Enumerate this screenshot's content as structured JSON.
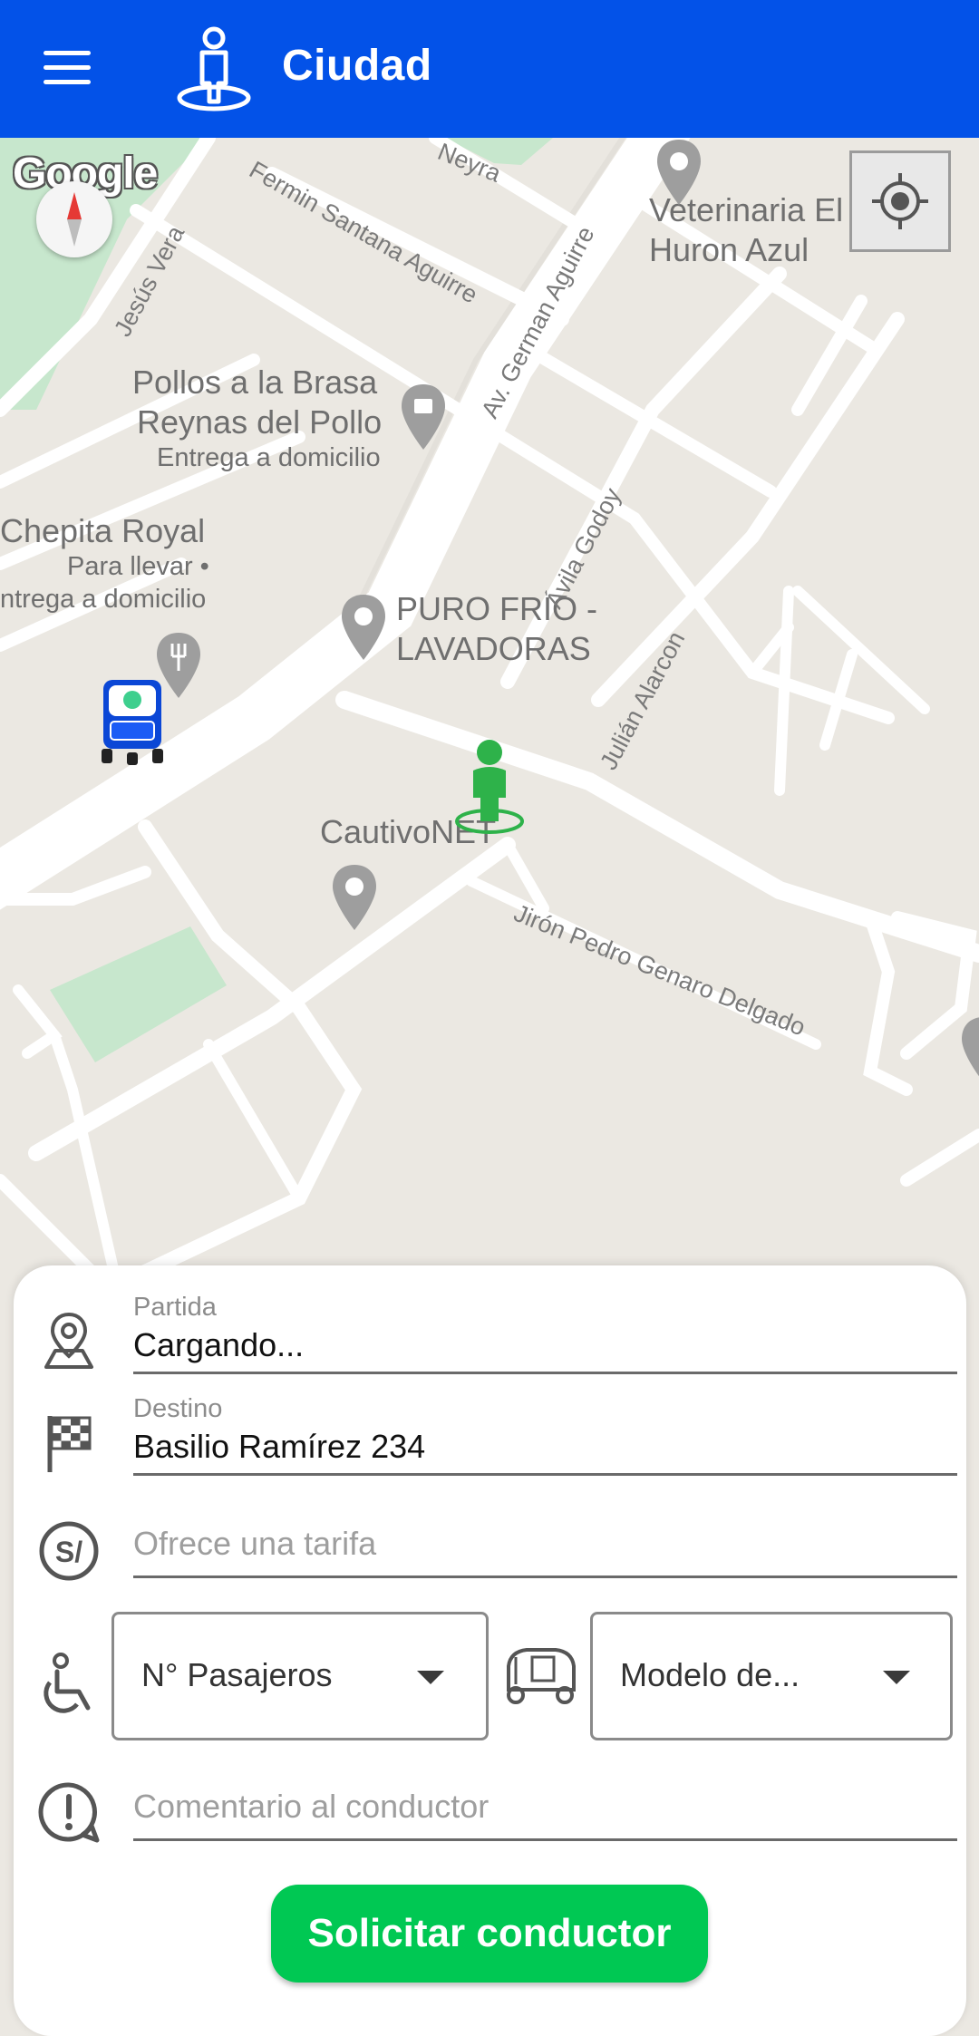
{
  "appbar": {
    "title": "Ciudad",
    "bg_color": "#0352e8"
  },
  "map": {
    "google_logo": "Google",
    "places": {
      "veterinaria_1": "Veterinaria El",
      "veterinaria_2": "Huron Azul",
      "pollos_1": "Pollos a la Brasa",
      "pollos_2": "Reynas del Pollo",
      "pollos_3": "Entrega a domicilio",
      "chepita_1": "Chepita Royal",
      "chepita_2": "Para llevar •",
      "chepita_3": "ntrega a domicilio",
      "purofrio_1": "PURO FRIO -",
      "purofrio_2": "LAVADORAS",
      "cautivo": "CautivoNET"
    },
    "streets": {
      "neyra": "Neyra",
      "fermin": "Fermin Santana Aguirre",
      "jesus": "Jesús Vera",
      "german": "Av. German Aguirre",
      "avila": "Ávila Godoy",
      "julian": "Julián Alarcon",
      "jiron": "Jirón Pedro Genaro Delgado"
    }
  },
  "form": {
    "origin": {
      "label": "Partida",
      "value": "Cargando..."
    },
    "destination": {
      "label": "Destino",
      "value": "Basilio Ramírez 234"
    },
    "fare": {
      "placeholder": "Ofrece una tarifa"
    },
    "passengers": {
      "value": "N° Pasajeros"
    },
    "model": {
      "value": "Modelo de..."
    },
    "comment": {
      "placeholder": "Comentario al conductor"
    },
    "submit_label": "Solicitar conductor",
    "submit_color": "#00c853"
  }
}
